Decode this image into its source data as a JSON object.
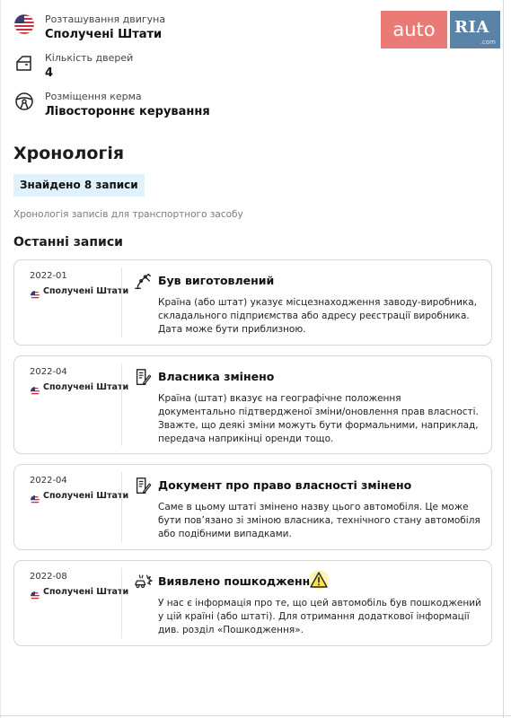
{
  "logo": {
    "auto": "auto",
    "ria": "RIA",
    "com": ".com"
  },
  "specs": [
    {
      "icon": "us-flag-icon",
      "label": "Розташування двигуна",
      "value": "Сполучені Штати"
    },
    {
      "icon": "car-door-icon",
      "label": "Кількість дверей",
      "value": "4"
    },
    {
      "icon": "steering-wheel-icon",
      "label": "Розміщення керма",
      "value": "Лівостороннє керування"
    }
  ],
  "history": {
    "title": "Хронологія",
    "found": "Знайдено 8 записи",
    "subtitle": "Хронологія записів для транспортного засобу",
    "recent_title": "Останні записи"
  },
  "records": [
    {
      "date": "2022-01",
      "country": "Сполучені Штати",
      "icon": "robot-arm-icon",
      "title": "Був виготовлений",
      "desc": "Країна (або штат) указує місцезнаходження заводу-виробника, складального підприємства або адресу реєстрації виробника. Дата може бути приблизною."
    },
    {
      "date": "2022-04",
      "country": "Сполучені Штати",
      "icon": "document-pen-icon",
      "title": "Власника змінено",
      "desc": "Країна (штат) вказує на географічне положення документально підтвердженої зміни/оновлення прав власності. Зважте, що деякі зміни можуть бути формальними, наприклад, передача наприкінці оренди тощо."
    },
    {
      "date": "2022-04",
      "country": "Сполучені Штати",
      "icon": "document-pen-icon",
      "title": "Документ про право власності змінено",
      "desc": "Саме в цьому штаті змінено назву цього автомобіля. Це може бути пов’язано зі зміною власника, технічного стану автомобіля або подібними випадками."
    },
    {
      "date": "2022-08",
      "country": "Сполучені Штати",
      "icon": "car-crash-icon",
      "title": "Виявлено пошкодження",
      "warning": true,
      "desc": "У нас є інформація про те, що цей автомобіль був пошкоджений у цій країні (або штаті). Для отримання додаткової інформації див. розділ «Пошкодження»."
    }
  ],
  "colors": {
    "auto_red": "#e97a75",
    "ria_blue": "#5a83a8",
    "badge_bg": "#dff1fb",
    "warning_yellow": "#ffe14a"
  }
}
